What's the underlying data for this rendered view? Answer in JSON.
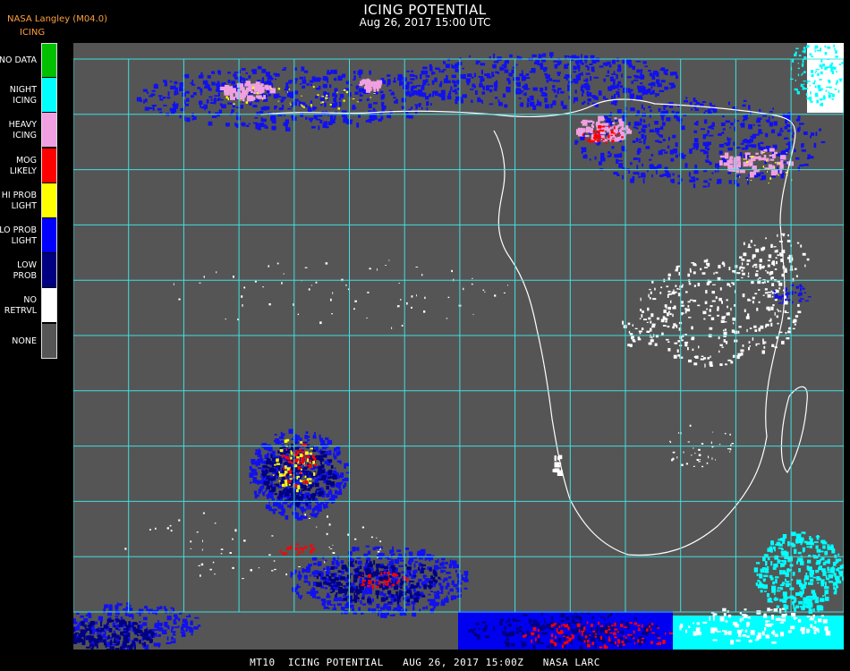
{
  "header": {
    "title": "ICING POTENTIAL",
    "subtitle": "Aug 26, 2017 15:00 UTC",
    "producer": "NASA Langley (M04.0)",
    "product": "ICING"
  },
  "legend": {
    "items": [
      {
        "label": "NO DATA",
        "color": "#00c000"
      },
      {
        "label": "NIGHT\nICING",
        "color": "#00ffff"
      },
      {
        "label": "HEAVY\nICING",
        "color": "#f0a0e0"
      },
      {
        "label": "MOG\nLIKELY",
        "color": "#ff0000"
      },
      {
        "label": "HI PROB\nLIGHT",
        "color": "#ffff00"
      },
      {
        "label": "LO PROB\nLIGHT",
        "color": "#0000ff"
      },
      {
        "label": "LOW\nPROB",
        "color": "#000080"
      },
      {
        "label": "NO\nRETRVL",
        "color": "#ffffff"
      },
      {
        "label": "NONE",
        "color": "#555555"
      }
    ]
  },
  "map": {
    "background_color": "#555555",
    "grid_color": "#40e0e0",
    "coastline_color": "#ffffff",
    "label_color": "#c04040"
  },
  "footer": {
    "text": "MT10  ICING POTENTIAL   AUG 26, 2017 15:00Z   NASA LARC"
  }
}
